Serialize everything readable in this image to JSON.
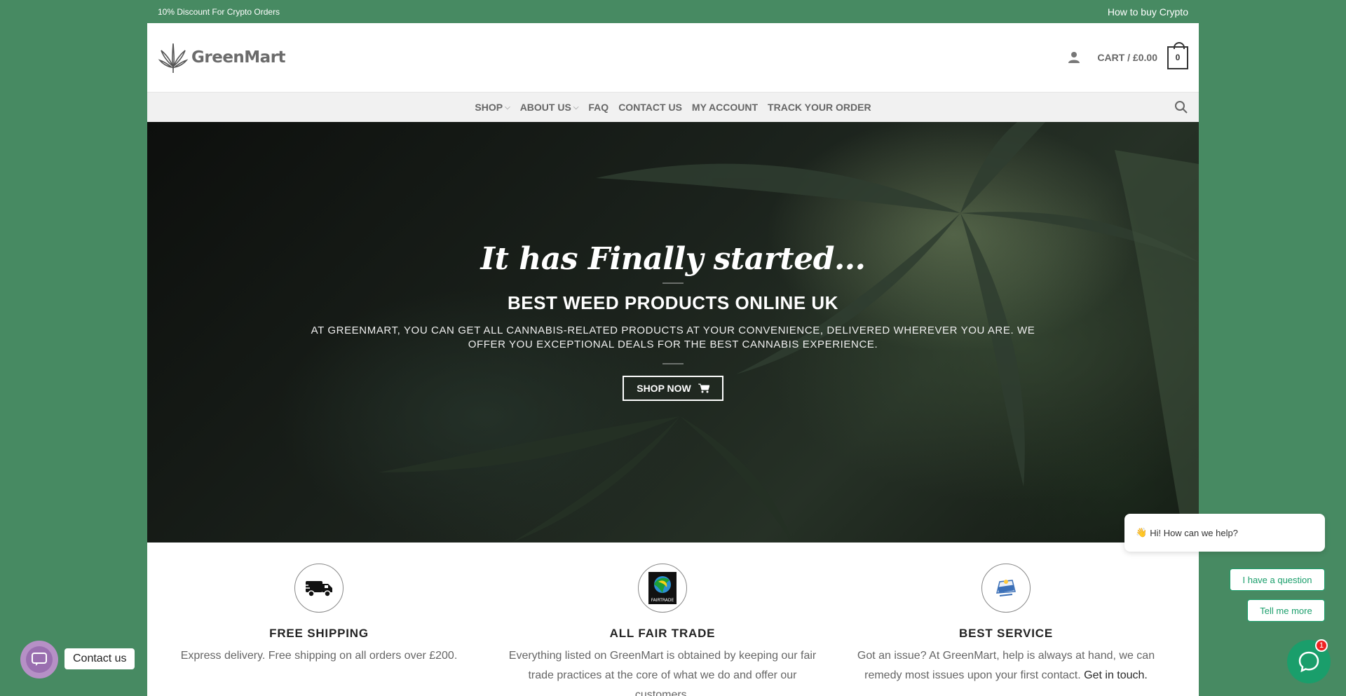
{
  "topbar": {
    "left_text": "10% Discount For Crypto Orders",
    "right_link": "How to buy Crypto"
  },
  "header": {
    "logo_text": "GreenMart",
    "cart_label": "CART / £0.00",
    "cart_count": "0"
  },
  "nav": {
    "items": [
      {
        "label": "SHOP",
        "dropdown": true
      },
      {
        "label": "ABOUT US",
        "dropdown": true
      },
      {
        "label": "FAQ",
        "dropdown": false
      },
      {
        "label": "CONTACT US",
        "dropdown": false
      },
      {
        "label": "MY ACCOUNT",
        "dropdown": false
      },
      {
        "label": "TRACK YOUR ORDER",
        "dropdown": false
      }
    ],
    "chevron": "⌵"
  },
  "hero": {
    "script_title": "It has Finally started...",
    "heading": "BEST WEED PRODUCTS ONLINE UK",
    "paragraph": "AT GREENMART, YOU CAN GET ALL CANNABIS-RELATED PRODUCTS AT YOUR CONVENIENCE, DELIVERED WHEREVER YOU ARE. WE OFFER YOU EXCEPTIONAL DEALS FOR THE BEST CANNABIS EXPERIENCE.",
    "button_label": "SHOP NOW"
  },
  "features": [
    {
      "icon": "truck-icon",
      "title": "FREE SHIPPING",
      "text": "Express delivery. Free shipping on all orders over £200."
    },
    {
      "icon": "fairtrade-icon",
      "icon_text": "FAIRTRADE",
      "title": "ALL FAIR TRADE",
      "text": "Everything listed on GreenMart is obtained by keeping our fair trade practices at the core of what we do and offer our customers."
    },
    {
      "icon": "best-service-icon",
      "title": "BEST SERVICE",
      "text": "Got an issue? At GreenMart, help is always at hand, we can remedy most issues upon your first contact.",
      "link": "Get in touch."
    }
  ],
  "chat": {
    "greeting_emoji": "👋",
    "greeting": "Hi! How can we help?",
    "option_1": "I have a question",
    "option_2": "Tell me more",
    "badge": "1"
  },
  "contact_widget": {
    "label": "Contact us"
  },
  "colors": {
    "brand_green": "#478a62",
    "chat_green": "#1a9e6b",
    "contact_purple": "#b690c6"
  }
}
